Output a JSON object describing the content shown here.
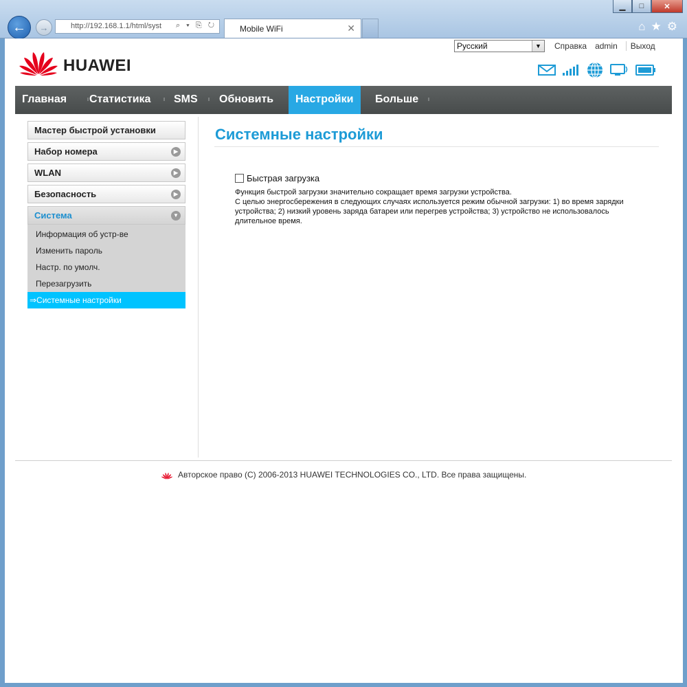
{
  "browser": {
    "url": "http://192.168.1.1/html/syst",
    "tab_title": "Mobile WiFi",
    "tab_close": "✕",
    "address_icons": "⌕ ▾ ⎘ ↻"
  },
  "header": {
    "brand": "HUAWEI",
    "language": "Русский",
    "links": [
      "Справка",
      "admin",
      "Выход"
    ]
  },
  "menu": {
    "items": [
      "Главная",
      "Статистика",
      "SMS",
      "Обновить",
      "Настройки",
      "Больше"
    ],
    "active": "Настройки"
  },
  "sidebar": {
    "items": [
      "Мастер быстрой установки",
      "Набор номера",
      "WLAN",
      "Безопасность",
      "Система"
    ],
    "open": "Система",
    "sub_items": [
      "Информация об устр-ве",
      "Изменить пароль",
      "Настр. по умолч.",
      "Перезагрузить",
      "⇒Системные настройки"
    ]
  },
  "main": {
    "title": "Системные настройки",
    "checkbox_label": "Быстрая загрузка",
    "checkbox_checked": false,
    "description_1": "Функция быстрой загрузки значительно сокращает время загрузки устройства.",
    "description_2": "С целью энергосбережения в следующих случаях используется режим обычной загрузки: 1) во время зарядки устройства; 2) низкий уровень заряда батареи или перегрев устройства; 3) устройство не использовалось длительное время."
  },
  "footer": {
    "copyright": "Авторское право (C) 2006-2013 HUAWEI TECHNOLOGIES CO., LTD. Все права защищены."
  },
  "colors": {
    "accent": "#1d9bd6",
    "menu_active": "#28a8e4",
    "selected_sub": "#00c3ff",
    "logo_red": "#e5001c"
  }
}
